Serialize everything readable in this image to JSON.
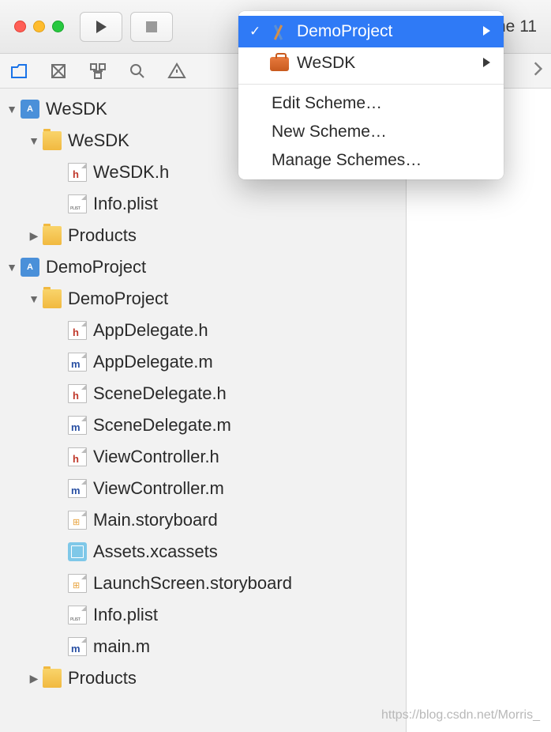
{
  "toolbar": {
    "device_label_fragment": "ne 11"
  },
  "scheme_menu": {
    "items": [
      {
        "label": "DemoProject",
        "selected": true,
        "icon": "app"
      },
      {
        "label": "WeSDK",
        "selected": false,
        "icon": "toolbox"
      }
    ],
    "actions": {
      "edit": "Edit Scheme…",
      "new": "New Scheme…",
      "manage": "Manage Schemes…"
    }
  },
  "navigator": {
    "projects": [
      {
        "name": "WeSDK",
        "expanded": true,
        "children": [
          {
            "name": "WeSDK",
            "type": "folder",
            "expanded": true,
            "children": [
              {
                "name": "WeSDK.h",
                "type": "h"
              },
              {
                "name": "Info.plist",
                "type": "plist"
              }
            ]
          },
          {
            "name": "Products",
            "type": "folder",
            "expanded": false
          }
        ]
      },
      {
        "name": "DemoProject",
        "expanded": true,
        "children": [
          {
            "name": "DemoProject",
            "type": "folder",
            "expanded": true,
            "children": [
              {
                "name": "AppDelegate.h",
                "type": "h"
              },
              {
                "name": "AppDelegate.m",
                "type": "m"
              },
              {
                "name": "SceneDelegate.h",
                "type": "h"
              },
              {
                "name": "SceneDelegate.m",
                "type": "m"
              },
              {
                "name": "ViewController.h",
                "type": "h"
              },
              {
                "name": "ViewController.m",
                "type": "m"
              },
              {
                "name": "Main.storyboard",
                "type": "sb"
              },
              {
                "name": "Assets.xcassets",
                "type": "assets"
              },
              {
                "name": "LaunchScreen.storyboard",
                "type": "sb"
              },
              {
                "name": "Info.plist",
                "type": "plist"
              },
              {
                "name": "main.m",
                "type": "m"
              }
            ]
          },
          {
            "name": "Products",
            "type": "folder",
            "expanded": false
          }
        ]
      }
    ]
  },
  "watermark": "https://blog.csdn.net/Morris_"
}
